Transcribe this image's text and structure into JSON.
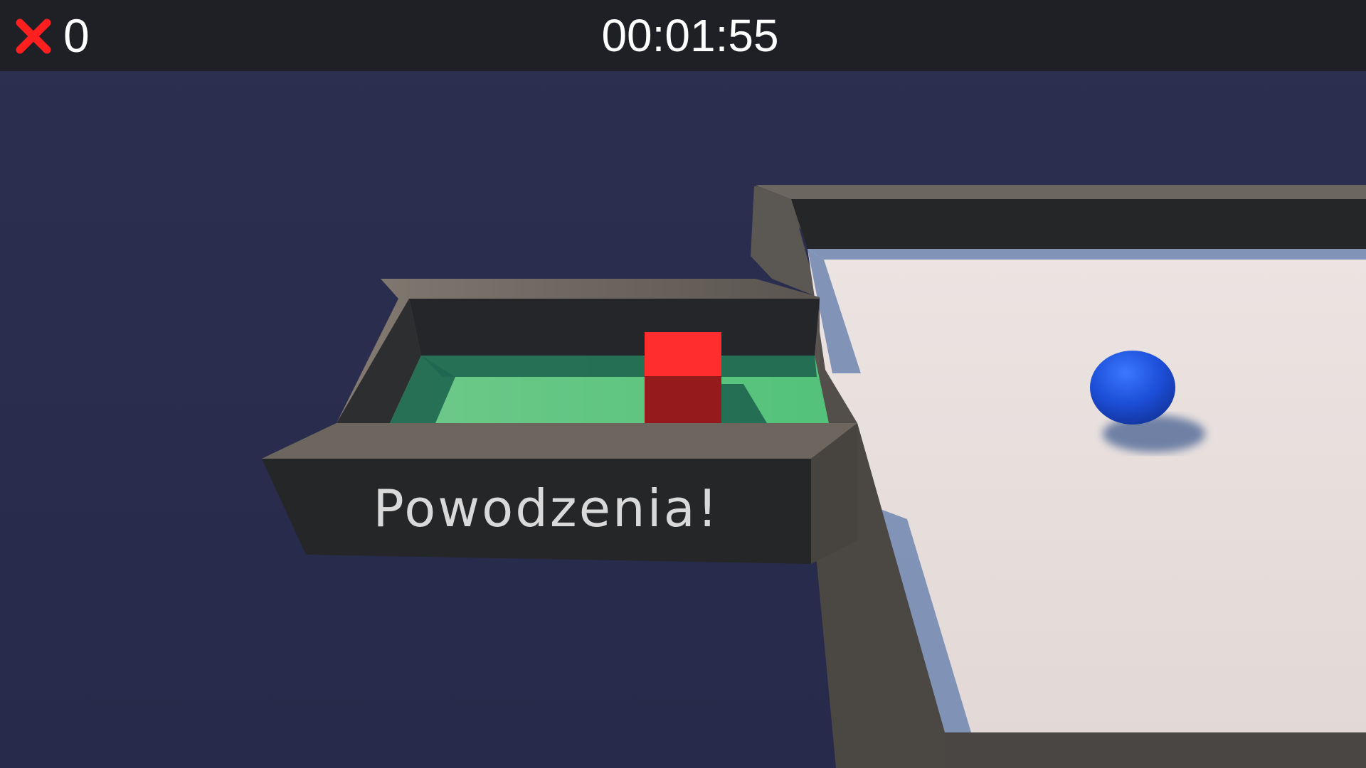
{
  "hud": {
    "fail_icon": "red-x-icon",
    "fail_count": "0",
    "timer": "00:01:55"
  },
  "scene": {
    "sign_text": "Powodzenia!",
    "colors": {
      "background": "#2a2d4f",
      "floor": "#e6ddd9",
      "wall_top": "#6f6a65",
      "wall_face": "#252628",
      "goal_green": "#5ec683",
      "obstacle_red": "#ff2d2d",
      "ball_blue": "#1d4fd9"
    }
  }
}
